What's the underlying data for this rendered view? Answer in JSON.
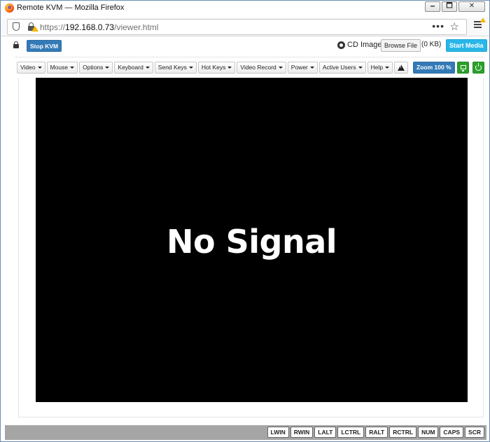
{
  "window": {
    "title": "Remote KVM — Mozilla Firefox",
    "minimize": "🗕",
    "maximize": "🗖",
    "close": "✕"
  },
  "addressbar": {
    "url_prefix": "https://",
    "url_host": "192.168.0.73",
    "url_path": "/viewer.html",
    "page_actions": "•••",
    "bookmark": "☆"
  },
  "session": {
    "stop_label": "Stop KVM"
  },
  "cd": {
    "label": "CD Image:",
    "browse_label": "Browse File",
    "size": "(0 KB)",
    "start_label": "Start Media"
  },
  "toolbar": {
    "menus": [
      {
        "label": "Video",
        "name": "menu-video"
      },
      {
        "label": "Mouse",
        "name": "menu-mouse"
      },
      {
        "label": "Options",
        "name": "menu-options"
      },
      {
        "label": "Keyboard",
        "name": "menu-keyboard"
      },
      {
        "label": "Send Keys",
        "name": "menu-send-keys"
      },
      {
        "label": "Hot Keys",
        "name": "menu-hot-keys"
      },
      {
        "label": "Video Record",
        "name": "menu-video-record"
      },
      {
        "label": "Power",
        "name": "menu-power"
      },
      {
        "label": "Active Users",
        "name": "menu-active-users"
      },
      {
        "label": "Help",
        "name": "menu-help"
      }
    ],
    "zoom_label": "Zoom 100 %"
  },
  "viewer": {
    "message": "No Signal"
  },
  "statusbar": {
    "keys": [
      "LWIN",
      "RWIN",
      "LALT",
      "LCTRL",
      "RALT",
      "RCTRL",
      "NUM",
      "CAPS",
      "SCR"
    ]
  }
}
